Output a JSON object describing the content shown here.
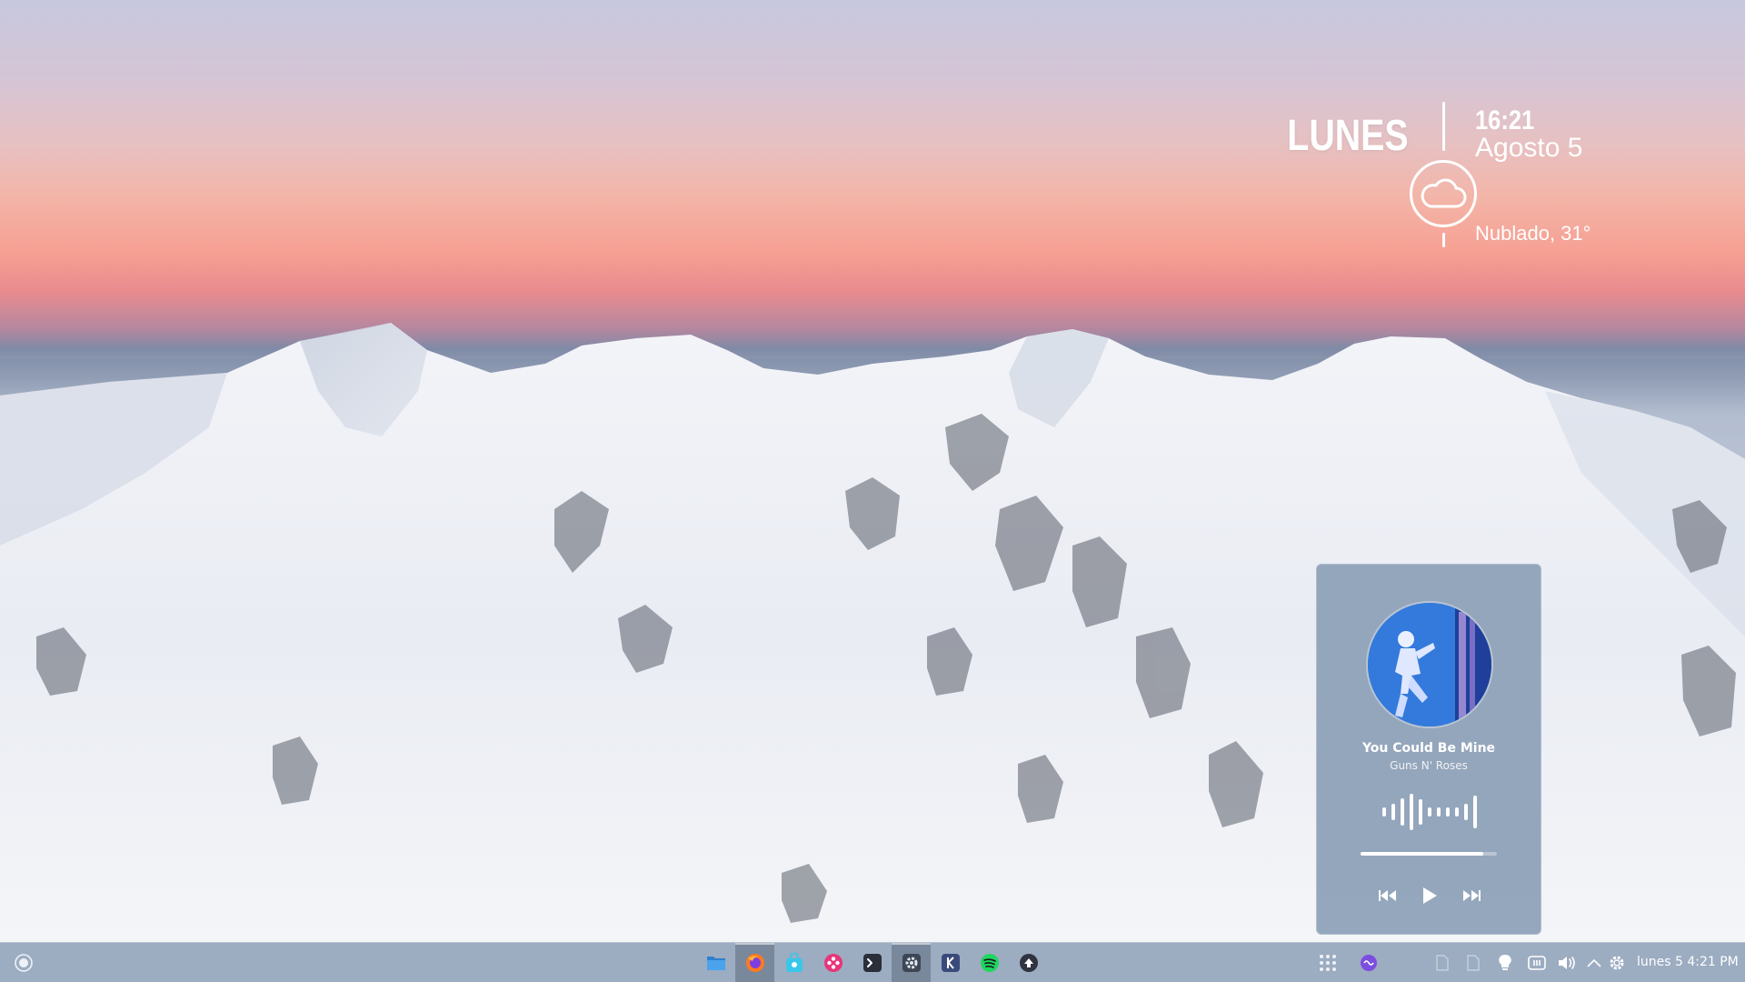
{
  "desktop": {
    "wallpaper": "snowy-mountain-sunset"
  },
  "clock_widget": {
    "day": "LUNES",
    "time": "16:21",
    "date": "Agosto 5",
    "weather": "Nublado, 31°",
    "weather_icon": "cloud-icon"
  },
  "media_player": {
    "title": "You Could Be Mine",
    "artist": "Guns N' Roses",
    "progress": 0.9,
    "controls": [
      "previous-icon",
      "play-icon",
      "next-icon"
    ]
  },
  "taskbar": {
    "launcher_icon": "app-launcher-icon",
    "apps": [
      {
        "name": "files",
        "icon": "folder-icon",
        "color": "#3a8fd9",
        "active": false
      },
      {
        "name": "firefox",
        "icon": "firefox-icon",
        "color": "#ff7a1f",
        "active": true
      },
      {
        "name": "store",
        "icon": "store-bag-icon",
        "color": "#38c7e8",
        "active": false
      },
      {
        "name": "flower-app",
        "icon": "flower-icon",
        "color": "#e8357a",
        "active": false
      },
      {
        "name": "terminal",
        "icon": "terminal-icon",
        "color": "#2b2f3a",
        "active": false
      },
      {
        "name": "settings",
        "icon": "gear-icon",
        "color": "#3c4654",
        "active": true
      },
      {
        "name": "kate",
        "icon": "kate-icon",
        "color": "#3a4a7a",
        "active": false
      },
      {
        "name": "spotify",
        "icon": "spotify-icon",
        "color": "#1ed760",
        "active": false
      },
      {
        "name": "app",
        "icon": "app-icon",
        "color": "#2f3440",
        "active": false
      }
    ],
    "tray_clock": "lunes 5 4:21 PM"
  }
}
